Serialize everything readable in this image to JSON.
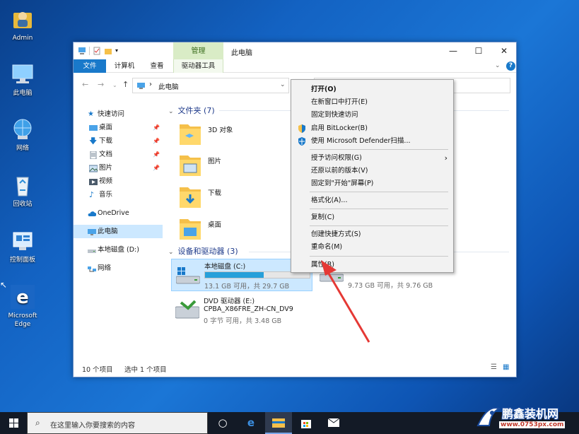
{
  "desktop": {
    "icons": [
      {
        "label": "Admin",
        "icon": "user-folder-icon"
      },
      {
        "label": "此电脑",
        "icon": "computer-icon"
      },
      {
        "label": "网络",
        "icon": "network-icon"
      },
      {
        "label": "回收站",
        "icon": "recycle-bin-icon"
      },
      {
        "label": "控制面板",
        "icon": "control-panel-icon"
      },
      {
        "label": "Microsoft Edge",
        "icon": "edge-icon"
      }
    ]
  },
  "window": {
    "title": "此电脑",
    "context_tab": "管理",
    "controls": {
      "minimize": "—",
      "maximize": "☐",
      "close": "✕"
    },
    "ribbon_tabs": [
      "文件",
      "计算机",
      "查看",
      "驱动器工具"
    ],
    "address": {
      "path_sep": "›",
      "path": "此电脑"
    },
    "nav": {
      "quick_access": "快速访问",
      "items": [
        "桌面",
        "下载",
        "文档",
        "图片",
        "视频",
        "音乐"
      ],
      "onedrive": "OneDrive",
      "this_pc": "此电脑",
      "local_disk": "本地磁盘 (D:)",
      "network": "网络"
    },
    "folders_group": "文件夹 (7)",
    "folders": [
      "3D 对象",
      "图片",
      "下载",
      "桌面"
    ],
    "drives_group": "设备和驱动器 (3)",
    "drives": [
      {
        "name": "本地磁盘 (C:)",
        "sub": "13.1 GB 可用，共 29.7 GB",
        "used_fraction": 0.56
      },
      {
        "name": "",
        "sub": "9.73 GB 可用，共 9.76 GB",
        "used_fraction": 0.003
      },
      {
        "name": "DVD 驱动器 (E:)",
        "name2": "CPBA_X86FRE_ZH-CN_DV9",
        "sub": "0 字节 可用，共 3.48 GB"
      }
    ],
    "status": {
      "count": "10 个项目",
      "selected": "选中 1 个项目"
    }
  },
  "context_menu": {
    "items": [
      {
        "label": "打开(O)",
        "bold": true
      },
      {
        "label": "在新窗口中打开(E)"
      },
      {
        "label": "固定到快速访问"
      },
      {
        "label": "启用 BitLocker(B)",
        "icon": "shield-icon"
      },
      {
        "label": "使用 Microsoft Defender扫描...",
        "icon": "defender-icon"
      },
      {
        "label": "授予访问权限(G)",
        "submenu": "›"
      },
      {
        "label": "还原以前的版本(V)"
      },
      {
        "label": "固定到\"开始\"屏幕(P)"
      },
      {
        "label": "格式化(A)..."
      },
      {
        "label": "复制(C)"
      },
      {
        "label": "创建快捷方式(S)"
      },
      {
        "label": "重命名(M)"
      },
      {
        "label": "属性(R)"
      }
    ]
  },
  "taskbar": {
    "search_placeholder": "在这里输入你要搜索的内容"
  },
  "watermark": {
    "brand": "鹏鑫装机网",
    "url": "www.0753px.com"
  },
  "colors": {
    "accent": "#1979ca",
    "arrow": "#e53935",
    "selection": "#cce8ff"
  }
}
